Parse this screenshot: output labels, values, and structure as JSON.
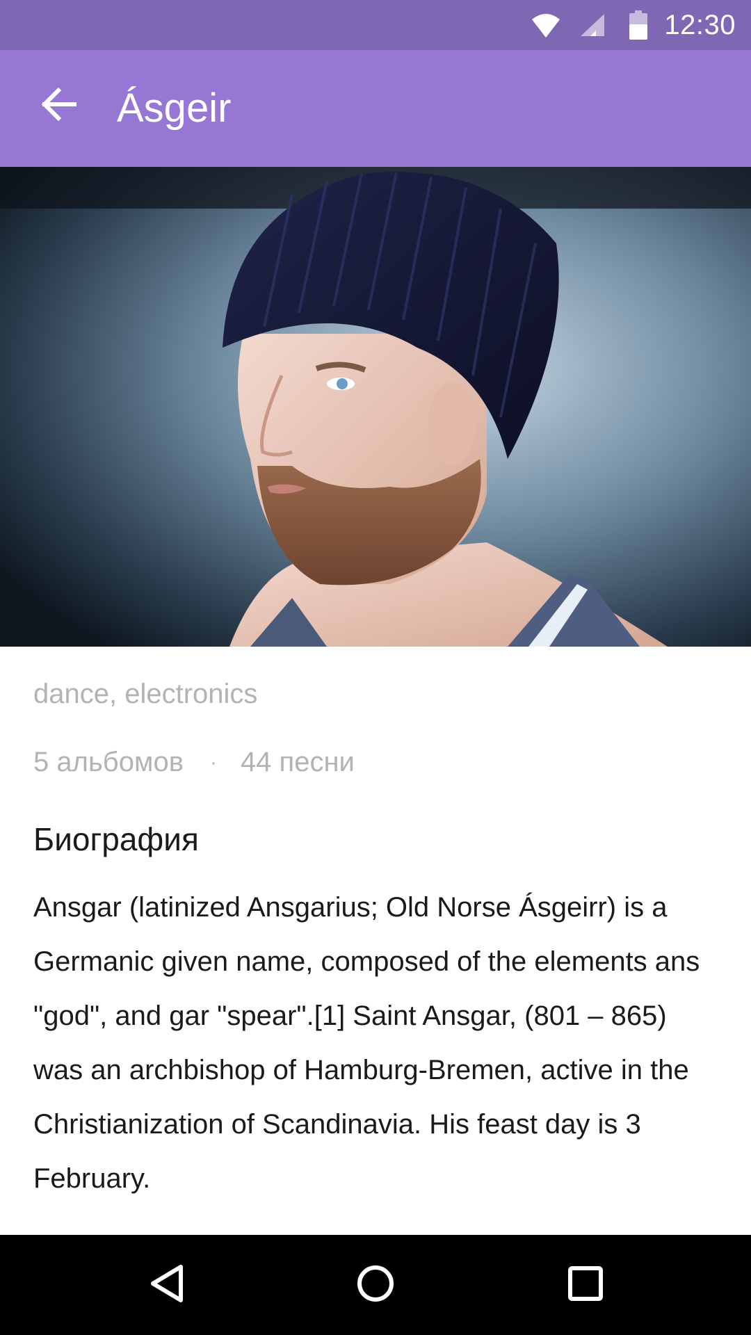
{
  "status_bar": {
    "time": "12:30",
    "icons": [
      "wifi-icon",
      "cellular-signal-icon",
      "battery-icon"
    ]
  },
  "app_bar": {
    "back_icon": "arrow-back-icon",
    "title": "Ásgeir",
    "color": "#9678d4"
  },
  "hero_image": {
    "description_icon": "artist-photo"
  },
  "artist": {
    "genres": "dance, electronics",
    "albums": "5 альбомов",
    "separator": "·",
    "songs": "44 песни"
  },
  "biography": {
    "heading": "Биография",
    "text": "Ansgar (latinized Ansgarius; Old Norse Ásgeirr) is a Germanic given name, composed of the elements ans \"god\", and gar \"spear\".[1] Saint Ansgar, (801 – 865) was an archbishop of Hamburg-Bremen, active in the Christianization of Scandinavia. His feast day is 3 February."
  },
  "nav_bar": {
    "buttons": [
      "back-triangle-icon",
      "home-circle-icon",
      "recents-square-icon"
    ]
  },
  "colors": {
    "status_bar": "#7f68b3",
    "app_bar": "#9678d4",
    "secondary_text": "#b3b3b3",
    "primary_text": "#1a1a1a"
  }
}
